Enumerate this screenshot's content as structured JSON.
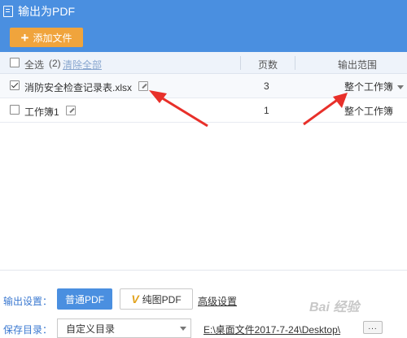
{
  "window": {
    "title": "输出为PDF"
  },
  "toolbar": {
    "add_icon": "+",
    "add_label": "添加文件"
  },
  "table": {
    "select_all_label": "全选",
    "count_text": "(2)",
    "clear_all_label": "清除全部",
    "col_pages": "页数",
    "col_range": "输出范围",
    "rows": [
      {
        "checked": true,
        "name": "消防安全检查记录表.xlsx",
        "pages": "3",
        "range": "整个工作簿"
      },
      {
        "checked": false,
        "name": "工作簿1",
        "pages": "1",
        "range": "整个工作簿"
      }
    ]
  },
  "bottom": {
    "output_settings_label": "输出设置：",
    "normal_pdf_label": "普通PDF",
    "vip_icon": "V",
    "pure_pdf_label": "纯图PDF",
    "advanced_label": "高级设置",
    "save_dir_label": "保存目录：",
    "save_dir_value": "自定义目录",
    "path_value": "E:\\桌面文件2017-7-24\\Desktop\\",
    "more_label": "..."
  },
  "watermark": "Bai 经验",
  "colors": {
    "header_blue": "#4a8fe0",
    "add_orange": "#f0a43c",
    "arrow_red": "#e8302a"
  }
}
